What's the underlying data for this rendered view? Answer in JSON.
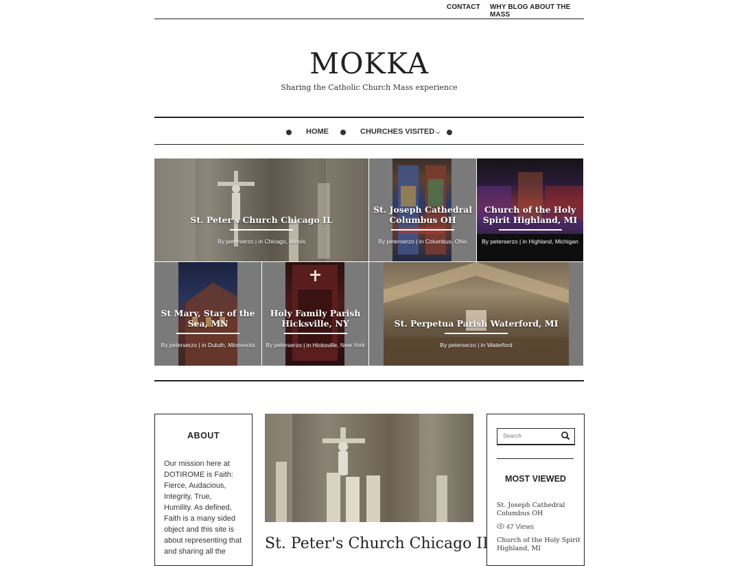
{
  "topnav": {
    "contact": "CONTACT",
    "why": "WHY BLOG ABOUT THE MASS"
  },
  "site": {
    "title": "MOKKA",
    "tagline": "Sharing the Catholic Church Mass experience"
  },
  "mainnav": {
    "home": "HOME",
    "churches": "CHURCHES VISITED"
  },
  "tiles": [
    {
      "title": "St. Peter's Church Chicago IL",
      "by": "By",
      "author": "peterserzo",
      "in": "in",
      "place": "Chicago, Illinois"
    },
    {
      "title": "St. Joseph Cathedral Columbus OH",
      "by": "By",
      "author": "peterserzo",
      "in": "in",
      "place": "Columbus, Ohio"
    },
    {
      "title": "Church of the Holy Spirit Highland, MI",
      "by": "By",
      "author": "peterserzo",
      "in": "in",
      "place": "Highland, Michigan"
    },
    {
      "title": "St Mary, Star of the Sea, MN",
      "by": "By",
      "author": "peterserzo",
      "in": "in",
      "place": "Duluth, Minnesota"
    },
    {
      "title": "Holy Family Parish Hicksville, NY",
      "by": "By",
      "author": "peterserzo",
      "in": "in",
      "place": "Hicksville, New York"
    },
    {
      "title": "St. Perpetua Parish Waterford, MI",
      "by": "By",
      "author": "peterserzo",
      "in": "in",
      "place": "Waterford"
    }
  ],
  "about": {
    "heading": "ABOUT",
    "lines": [
      "Our mission here at",
      "DOTIROME is Faith:",
      "Fierce, Audacious,",
      "Integrity, True,",
      "Humility. As defined,",
      "Faith is a many sided",
      "object and this site is",
      "about representing that",
      "and sharing all the"
    ]
  },
  "post": {
    "title": "St. Peter's Church Chicago IL"
  },
  "sidebar": {
    "search_placeholder": "Search",
    "most_viewed_heading": "MOST VIEWED",
    "items": [
      {
        "title_line1": "St. Joseph Cathedral",
        "title_line2": "Columbus OH",
        "views": "47 Views"
      },
      {
        "title_line1": "Church of the Holy Spirit",
        "title_line2": "Highland, MI"
      }
    ]
  },
  "colors": {
    "ink": "#222222",
    "tile_gray": "#7a7a7a"
  },
  "icons": {
    "search": "search-icon",
    "views": "eye-icon",
    "dropdown": "chevron-down-icon"
  }
}
